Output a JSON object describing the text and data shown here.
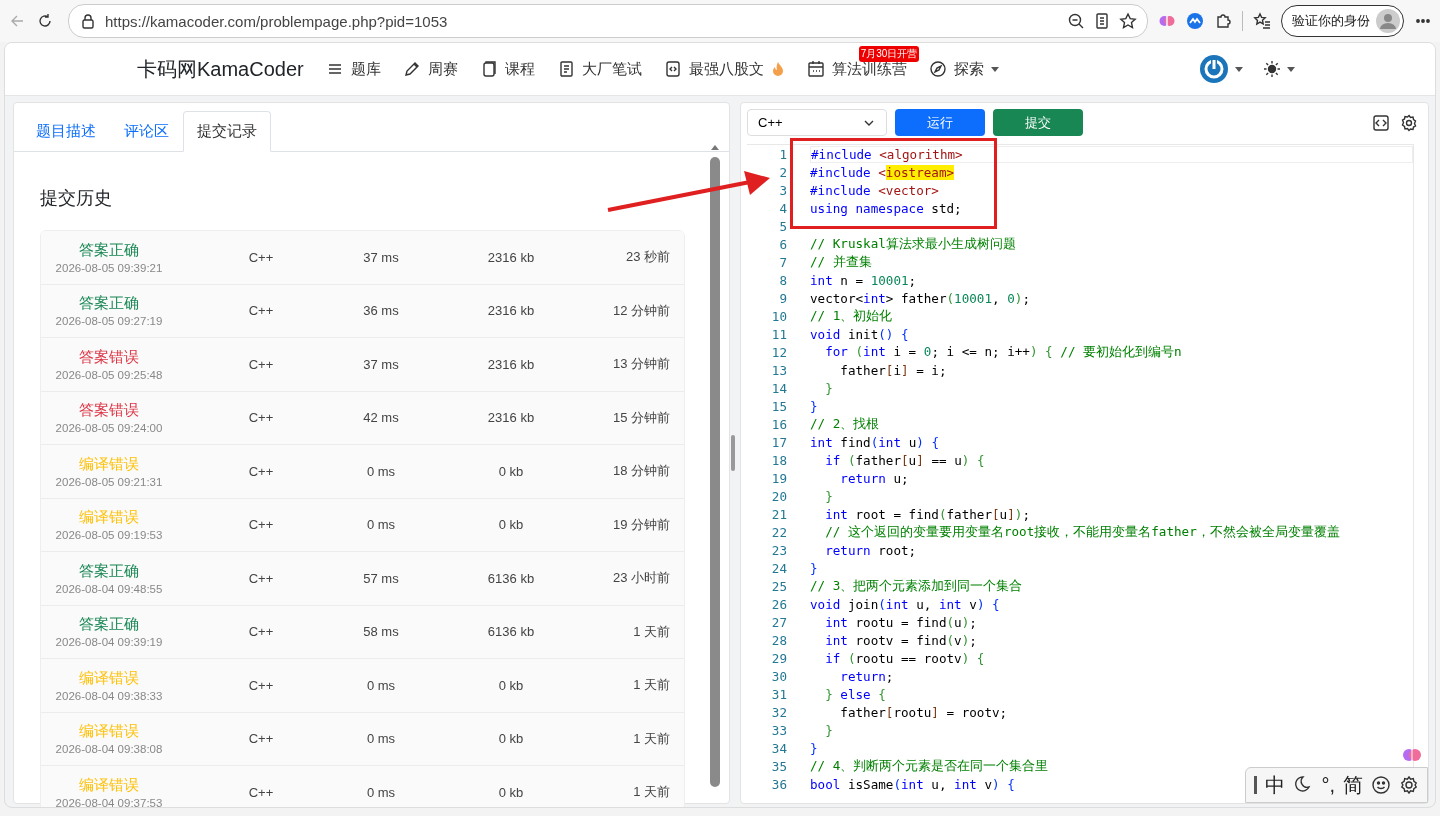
{
  "browser": {
    "url": "https://kamacoder.com/problempage.php?pid=1053",
    "profile_button": "验证你的身份"
  },
  "nav": {
    "logo": "卡码网KamaCoder",
    "items": [
      {
        "label": "题库",
        "dropdown": false
      },
      {
        "label": "周赛",
        "dropdown": false
      },
      {
        "label": "课程",
        "dropdown": false
      },
      {
        "label": "大厂笔试",
        "dropdown": false
      },
      {
        "label": "最强八股文",
        "dropdown": false
      },
      {
        "label": "算法训练营",
        "badge": "7月30日开营",
        "dropdown": false
      },
      {
        "label": "探索",
        "dropdown": true
      }
    ]
  },
  "tabs": [
    {
      "label": "题目描述",
      "selected": false
    },
    {
      "label": "评论区",
      "selected": false
    },
    {
      "label": "提交记录",
      "selected": true
    }
  ],
  "history": {
    "title": "提交历史",
    "rows": [
      {
        "result": "答案正确",
        "kind": "accepted",
        "time": "2026-08-05 09:39:21",
        "language": "C++",
        "runtime": "37 ms",
        "memory": "2316 kb",
        "ago": "23 秒前"
      },
      {
        "result": "答案正确",
        "kind": "accepted",
        "time": "2026-08-05 09:27:19",
        "language": "C++",
        "runtime": "36 ms",
        "memory": "2316 kb",
        "ago": "12 分钟前"
      },
      {
        "result": "答案错误",
        "kind": "wrong",
        "time": "2026-08-05 09:25:48",
        "language": "C++",
        "runtime": "37 ms",
        "memory": "2316 kb",
        "ago": "13 分钟前"
      },
      {
        "result": "答案错误",
        "kind": "wrong",
        "time": "2026-08-05 09:24:00",
        "language": "C++",
        "runtime": "42 ms",
        "memory": "2316 kb",
        "ago": "15 分钟前"
      },
      {
        "result": "编译错误",
        "kind": "compile_error",
        "time": "2026-08-05 09:21:31",
        "language": "C++",
        "runtime": "0 ms",
        "memory": "0 kb",
        "ago": "18 分钟前"
      },
      {
        "result": "编译错误",
        "kind": "compile_error",
        "time": "2026-08-05 09:19:53",
        "language": "C++",
        "runtime": "0 ms",
        "memory": "0 kb",
        "ago": "19 分钟前"
      },
      {
        "result": "答案正确",
        "kind": "accepted",
        "time": "2026-08-04 09:48:55",
        "language": "C++",
        "runtime": "57 ms",
        "memory": "6136 kb",
        "ago": "23 小时前"
      },
      {
        "result": "答案正确",
        "kind": "accepted",
        "time": "2026-08-04 09:39:19",
        "language": "C++",
        "runtime": "58 ms",
        "memory": "6136 kb",
        "ago": "1 天前"
      },
      {
        "result": "编译错误",
        "kind": "compile_error",
        "time": "2026-08-04 09:38:33",
        "language": "C++",
        "runtime": "0 ms",
        "memory": "0 kb",
        "ago": "1 天前"
      },
      {
        "result": "编译错误",
        "kind": "compile_error",
        "time": "2026-08-04 09:38:08",
        "language": "C++",
        "runtime": "0 ms",
        "memory": "0 kb",
        "ago": "1 天前"
      },
      {
        "result": "编译错误",
        "kind": "compile_error",
        "time": "2026-08-04 09:37:53",
        "language": "C++",
        "runtime": "0 ms",
        "memory": "0 kb",
        "ago": "1 天前"
      }
    ]
  },
  "editor": {
    "language": "C++",
    "run_button": "运行",
    "submit_button": "提交",
    "lines": [
      {
        "number": "1",
        "tokens": [
          {
            "kind": "kw",
            "text": "#include "
          },
          {
            "kind": "inc",
            "text": "<algorithm>"
          }
        ]
      },
      {
        "number": "2",
        "tokens": [
          {
            "kind": "kw",
            "text": "#include "
          },
          {
            "kind": "inc",
            "text": "<"
          },
          {
            "kind": "hl",
            "text": "iostream>"
          }
        ]
      },
      {
        "number": "3",
        "tokens": [
          {
            "kind": "kw",
            "text": "#include "
          },
          {
            "kind": "inc",
            "text": "<vector>"
          }
        ]
      },
      {
        "number": "4",
        "tokens": [
          {
            "kind": "kw",
            "text": "using namespace "
          },
          {
            "kind": "id",
            "text": "std;"
          }
        ]
      },
      {
        "number": "5"
      },
      {
        "number": "6",
        "tokens": [
          {
            "kind": "com",
            "text": "// Kruskal算法求最小生成树问题"
          }
        ]
      },
      {
        "number": "7",
        "tokens": [
          {
            "kind": "com",
            "text": "// 并查集"
          }
        ]
      },
      {
        "number": "8",
        "tokens": [
          {
            "kind": "kw",
            "text": "int "
          },
          {
            "kind": "id",
            "text": "n = "
          },
          {
            "kind": "num",
            "text": "10001"
          },
          {
            "kind": "id",
            "text": ";"
          }
        ]
      },
      {
        "number": "9",
        "tokens": [
          {
            "kind": "id",
            "text": "vector<"
          },
          {
            "kind": "kw",
            "text": "int"
          },
          {
            "kind": "id",
            "text": "> father"
          },
          {
            "kind": "b2",
            "text": "("
          },
          {
            "kind": "num",
            "text": "10001"
          },
          {
            "kind": "id",
            "text": ", "
          },
          {
            "kind": "num",
            "text": "0"
          },
          {
            "kind": "b2",
            "text": ")"
          },
          {
            "kind": "id",
            "text": ";"
          }
        ]
      },
      {
        "number": "10",
        "tokens": [
          {
            "kind": "com",
            "text": "// 1、初始化"
          }
        ]
      },
      {
        "number": "11",
        "tokens": [
          {
            "kind": "kw",
            "text": "void "
          },
          {
            "kind": "id",
            "text": "init"
          },
          {
            "kind": "b1",
            "text": "() {"
          }
        ]
      },
      {
        "number": "12",
        "tokens": [
          {
            "kind": "kw",
            "text": "  for "
          },
          {
            "kind": "b2",
            "text": "("
          },
          {
            "kind": "kw",
            "text": "int "
          },
          {
            "kind": "id",
            "text": "i = "
          },
          {
            "kind": "num",
            "text": "0"
          },
          {
            "kind": "id",
            "text": "; i <= n; i++"
          },
          {
            "kind": "b2",
            "text": ") { "
          },
          {
            "kind": "com",
            "text": "// 要初始化到编号n"
          }
        ]
      },
      {
        "number": "13",
        "tokens": [
          {
            "kind": "id",
            "text": "    father"
          },
          {
            "kind": "b3",
            "text": "["
          },
          {
            "kind": "id",
            "text": "i"
          },
          {
            "kind": "b3",
            "text": "]"
          },
          {
            "kind": "id",
            "text": " = i;"
          }
        ]
      },
      {
        "number": "14",
        "tokens": [
          {
            "kind": "b2",
            "text": "  }"
          }
        ]
      },
      {
        "number": "15",
        "tokens": [
          {
            "kind": "b1",
            "text": "}"
          }
        ]
      },
      {
        "number": "16",
        "tokens": [
          {
            "kind": "com",
            "text": "// 2、找根"
          }
        ]
      },
      {
        "number": "17",
        "tokens": [
          {
            "kind": "kw",
            "text": "int "
          },
          {
            "kind": "id",
            "text": "find"
          },
          {
            "kind": "b1",
            "text": "("
          },
          {
            "kind": "kw",
            "text": "int "
          },
          {
            "kind": "id",
            "text": "u"
          },
          {
            "kind": "b1",
            "text": ") {"
          }
        ]
      },
      {
        "number": "18",
        "tokens": [
          {
            "kind": "kw",
            "text": "  if "
          },
          {
            "kind": "b2",
            "text": "("
          },
          {
            "kind": "id",
            "text": "father"
          },
          {
            "kind": "b3",
            "text": "["
          },
          {
            "kind": "id",
            "text": "u"
          },
          {
            "kind": "b3",
            "text": "]"
          },
          {
            "kind": "id",
            "text": " == u"
          },
          {
            "kind": "b2",
            "text": ") {"
          }
        ]
      },
      {
        "number": "19",
        "tokens": [
          {
            "kind": "kw",
            "text": "    return "
          },
          {
            "kind": "id",
            "text": "u;"
          }
        ]
      },
      {
        "number": "20",
        "tokens": [
          {
            "kind": "b2",
            "text": "  }"
          }
        ]
      },
      {
        "number": "21",
        "tokens": [
          {
            "kind": "kw",
            "text": "  int "
          },
          {
            "kind": "id",
            "text": "root = find"
          },
          {
            "kind": "b2",
            "text": "("
          },
          {
            "kind": "id",
            "text": "father"
          },
          {
            "kind": "b3",
            "text": "["
          },
          {
            "kind": "id",
            "text": "u"
          },
          {
            "kind": "b3",
            "text": "]"
          },
          {
            "kind": "b2",
            "text": ")"
          },
          {
            "kind": "id",
            "text": ";"
          }
        ]
      },
      {
        "number": "22",
        "tokens": [
          {
            "kind": "com",
            "text": "  // 这个返回的变量要用变量名root接收，不能用变量名father，不然会被全局变量覆盖"
          }
        ]
      },
      {
        "number": "23",
        "tokens": [
          {
            "kind": "kw",
            "text": "  return "
          },
          {
            "kind": "id",
            "text": "root;"
          }
        ]
      },
      {
        "number": "24",
        "tokens": [
          {
            "kind": "b1",
            "text": "}"
          }
        ]
      },
      {
        "number": "25",
        "tokens": [
          {
            "kind": "com",
            "text": "// 3、把两个元素添加到同一个集合"
          }
        ]
      },
      {
        "number": "26",
        "tokens": [
          {
            "kind": "kw",
            "text": "void "
          },
          {
            "kind": "id",
            "text": "join"
          },
          {
            "kind": "b1",
            "text": "("
          },
          {
            "kind": "kw",
            "text": "int "
          },
          {
            "kind": "id",
            "text": "u, "
          },
          {
            "kind": "kw",
            "text": "int "
          },
          {
            "kind": "id",
            "text": "v"
          },
          {
            "kind": "b1",
            "text": ") {"
          }
        ]
      },
      {
        "number": "27",
        "tokens": [
          {
            "kind": "kw",
            "text": "  int "
          },
          {
            "kind": "id",
            "text": "rootu = find"
          },
          {
            "kind": "b2",
            "text": "("
          },
          {
            "kind": "id",
            "text": "u"
          },
          {
            "kind": "b2",
            "text": ")"
          },
          {
            "kind": "id",
            "text": ";"
          }
        ]
      },
      {
        "number": "28",
        "tokens": [
          {
            "kind": "kw",
            "text": "  int "
          },
          {
            "kind": "id",
            "text": "rootv = find"
          },
          {
            "kind": "b2",
            "text": "("
          },
          {
            "kind": "id",
            "text": "v"
          },
          {
            "kind": "b2",
            "text": ")"
          },
          {
            "kind": "id",
            "text": ";"
          }
        ]
      },
      {
        "number": "29",
        "tokens": [
          {
            "kind": "kw",
            "text": "  if "
          },
          {
            "kind": "b2",
            "text": "("
          },
          {
            "kind": "id",
            "text": "rootu == rootv"
          },
          {
            "kind": "b2",
            "text": ") {"
          }
        ]
      },
      {
        "number": "30",
        "tokens": [
          {
            "kind": "kw",
            "text": "    return"
          },
          {
            "kind": "id",
            "text": ";"
          }
        ]
      },
      {
        "number": "31",
        "tokens": [
          {
            "kind": "b2",
            "text": "  } "
          },
          {
            "kind": "kw",
            "text": "else "
          },
          {
            "kind": "b2",
            "text": "{"
          }
        ]
      },
      {
        "number": "32",
        "tokens": [
          {
            "kind": "id",
            "text": "    father"
          },
          {
            "kind": "b3",
            "text": "["
          },
          {
            "kind": "id",
            "text": "rootu"
          },
          {
            "kind": "b3",
            "text": "]"
          },
          {
            "kind": "id",
            "text": " = rootv;"
          }
        ]
      },
      {
        "number": "33",
        "tokens": [
          {
            "kind": "b2",
            "text": "  }"
          }
        ]
      },
      {
        "number": "34",
        "tokens": [
          {
            "kind": "b1",
            "text": "}"
          }
        ]
      },
      {
        "number": "35",
        "tokens": [
          {
            "kind": "com",
            "text": "// 4、判断两个元素是否在同一个集合里"
          }
        ]
      },
      {
        "number": "36",
        "tokens": [
          {
            "kind": "kw",
            "text": "bool "
          },
          {
            "kind": "id",
            "text": "isSame"
          },
          {
            "kind": "b1",
            "text": "("
          },
          {
            "kind": "kw",
            "text": "int "
          },
          {
            "kind": "id",
            "text": "u, "
          },
          {
            "kind": "kw",
            "text": "int "
          },
          {
            "kind": "id",
            "text": "v"
          },
          {
            "kind": "b1",
            "text": ") {"
          }
        ]
      }
    ]
  },
  "ime": {
    "items": [
      "中",
      "°,",
      "简"
    ]
  }
}
